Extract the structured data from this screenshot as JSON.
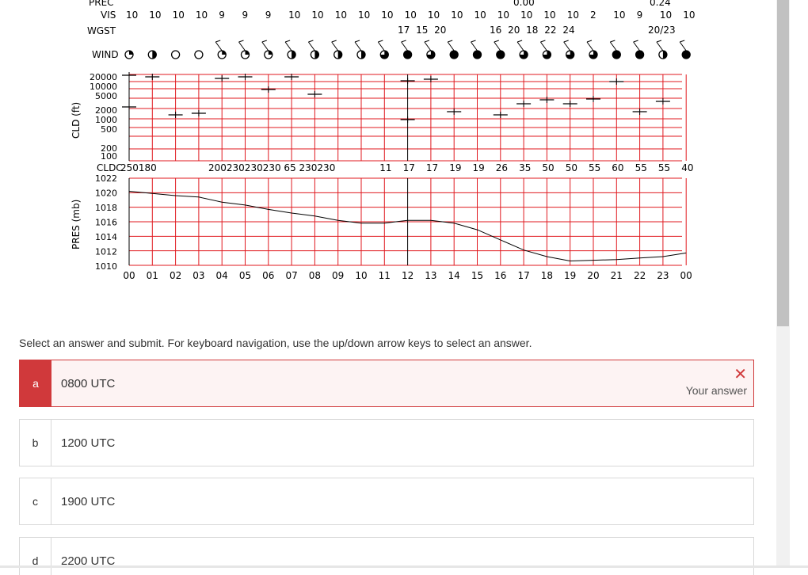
{
  "meteogram": {
    "rows": {
      "prec_label": "PREC",
      "prec_top": [
        "0.00",
        "0.24"
      ],
      "vis_label": "VIS",
      "vis_values": [
        "10",
        "10",
        "10",
        "10",
        "9",
        "9",
        "9",
        "10",
        "10",
        "10",
        "10",
        "10",
        "10",
        "10",
        "10",
        "10",
        "10",
        "10",
        "10",
        "10",
        "2",
        "10",
        "9",
        "10",
        "10"
      ],
      "wgst_label": "WGST",
      "wgst_values": [
        "17 15 20",
        "16 20 18 22 24",
        "20/23"
      ],
      "wind_label": "WIND",
      "cld_axis_label": "CLD (ft)",
      "cld_ticks": [
        "20000",
        "10000",
        "5000",
        "2000",
        "1000",
        "500",
        "200",
        "100"
      ],
      "cldc_label": "CLDC",
      "cldc_values": [
        "250180",
        "200230230230 65 230230",
        "11",
        "17",
        "17",
        "19",
        "19",
        "26",
        "35",
        "50",
        "50",
        "55",
        "60",
        "55",
        "55",
        "40"
      ],
      "pres_axis_label": "PRES (mb)",
      "pres_ticks": [
        "1022",
        "1020",
        "1018",
        "1016",
        "1014",
        "1012",
        "1010"
      ],
      "hours": [
        "00",
        "01",
        "02",
        "03",
        "04",
        "05",
        "06",
        "07",
        "08",
        "09",
        "10",
        "11",
        "12",
        "13",
        "14",
        "15",
        "16",
        "17",
        "18",
        "19",
        "20",
        "21",
        "22",
        "23",
        "00"
      ]
    },
    "pressure_mb": [
      1020.2,
      1019.9,
      1019.6,
      1019.4,
      1018.7,
      1018.3,
      1017.7,
      1017.2,
      1016.8,
      1016.2,
      1015.8,
      1015.8,
      1016.2,
      1016.2,
      1015.8,
      1014.9,
      1013.5,
      1012.1,
      1011.2,
      1010.6,
      1010.7,
      1010.8,
      1011.0,
      1011.2,
      1011.7
    ],
    "colors": {
      "grid": "#e0191f",
      "line": "#000000"
    }
  },
  "question": {
    "prompt": "Select an answer and submit. For keyboard navigation, use the up/down arrow keys to select an answer.",
    "options": [
      {
        "letter": "a",
        "label": "0800 UTC",
        "selected": true,
        "incorrect": true
      },
      {
        "letter": "b",
        "label": "1200 UTC"
      },
      {
        "letter": "c",
        "label": "1900 UTC"
      },
      {
        "letter": "d",
        "label": "2200 UTC"
      }
    ],
    "feedback": {
      "label": "Your answer",
      "icon": "x-icon",
      "color": "#d0393b"
    }
  }
}
